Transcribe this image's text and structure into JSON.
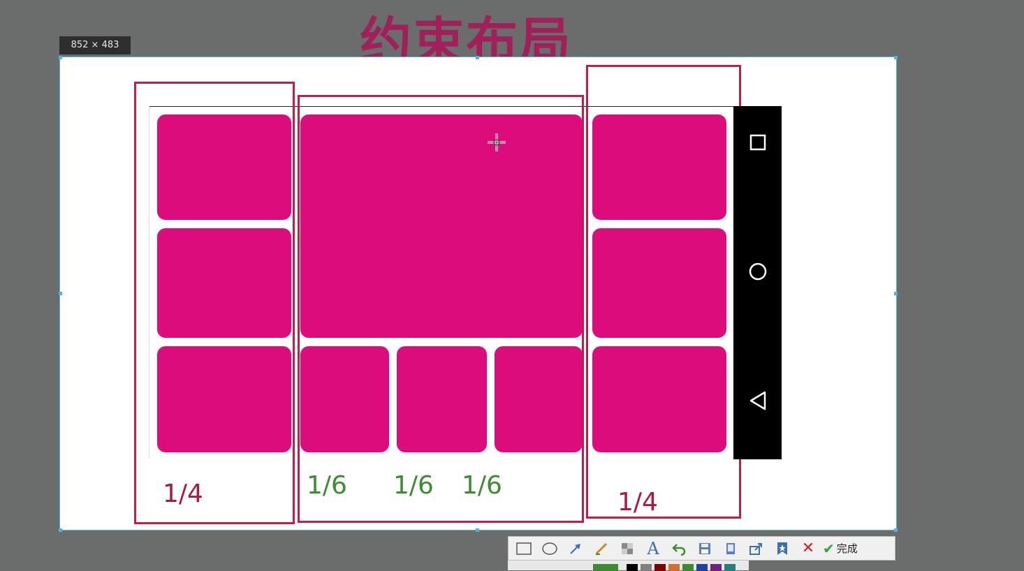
{
  "title": "约束布局",
  "size_badge": "852 × 483",
  "labels": {
    "left": "1/4",
    "center_1": "1/6",
    "center_2": "1/6",
    "center_3": "1/6",
    "right": "1/4"
  },
  "toolbar": {
    "done_label": "完成",
    "tools": [
      "rectangle-icon",
      "ellipse-icon",
      "arrow-icon",
      "pen-icon",
      "mosaic-icon",
      "text-icon",
      "undo-icon",
      "save-icon",
      "copy-icon",
      "share-icon",
      "pin-icon"
    ]
  },
  "colors": {
    "tile": "#dc0c7c",
    "frame": "#c01d47",
    "fraction_red": "#a91a3c",
    "fraction_green": "#3a8c2e",
    "selection": "#4fb3e8"
  }
}
